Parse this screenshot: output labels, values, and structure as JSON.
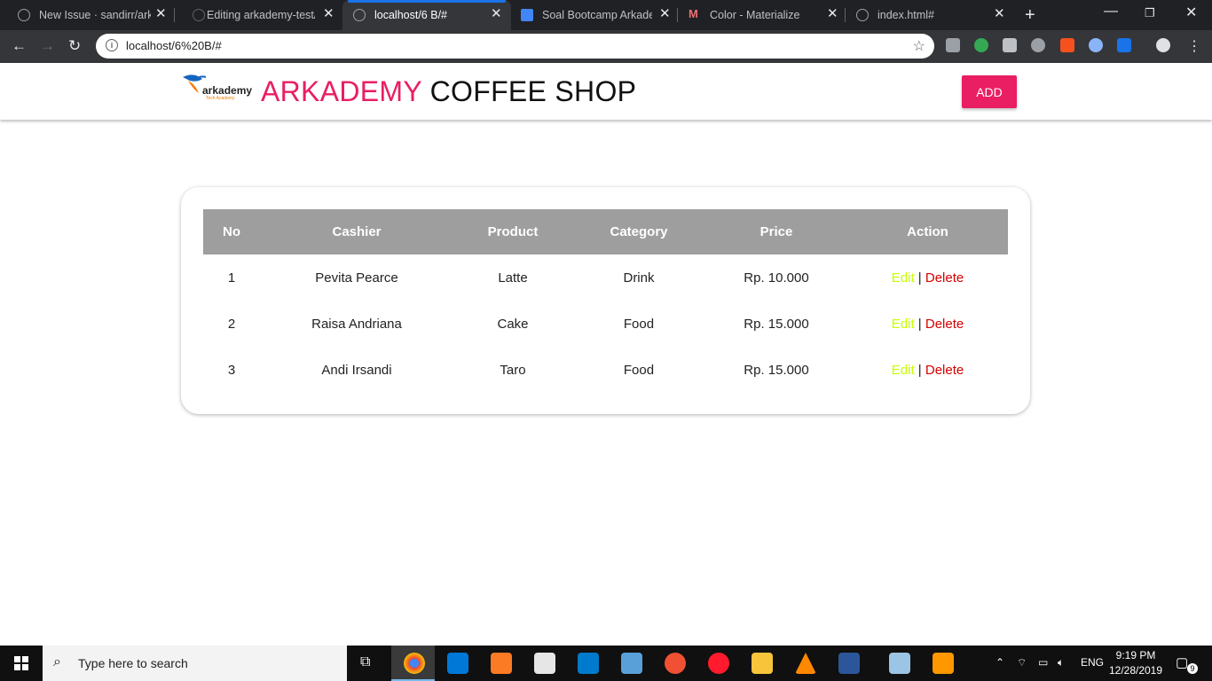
{
  "browser": {
    "tabs": [
      {
        "title": "New Issue · sandirr/arka",
        "active": false
      },
      {
        "title": "Editing arkademy-test/",
        "active": false
      },
      {
        "title": "localhost/6 B/#",
        "active": true
      },
      {
        "title": "Soal Bootcamp Arkader",
        "active": false
      },
      {
        "title": "Color - Materialize",
        "active": false
      },
      {
        "title": "index.html#",
        "active": false
      }
    ],
    "url": "localhost/6%20B/#"
  },
  "header": {
    "logo_text": "arkademy",
    "logo_subtext": "Tech Academy",
    "brand_accent": "ARKADEMY",
    "brand_rest": "COFFEE SHOP",
    "add_label": "ADD"
  },
  "table": {
    "headers": [
      "No",
      "Cashier",
      "Product",
      "Category",
      "Price",
      "Action"
    ],
    "rows": [
      {
        "no": "1",
        "cashier": "Pevita Pearce",
        "product": "Latte",
        "category": "Drink",
        "price": "Rp. 10.000"
      },
      {
        "no": "2",
        "cashier": "Raisa Andriana",
        "product": "Cake",
        "category": "Food",
        "price": "Rp. 15.000"
      },
      {
        "no": "3",
        "cashier": "Andi Irsandi",
        "product": "Taro",
        "category": "Food",
        "price": "Rp. 15.000"
      }
    ],
    "edit_label": "Edit",
    "separator": "|",
    "delete_label": "Delete"
  },
  "colors": {
    "accent": "#e91e63",
    "edit": "#c6ff00",
    "delete": "#d50000",
    "table_header": "#9e9e9e"
  },
  "taskbar": {
    "search_placeholder": "Type here to search",
    "language": "ENG",
    "time": "9:19 PM",
    "date": "12/28/2019",
    "notification_count": "9"
  }
}
